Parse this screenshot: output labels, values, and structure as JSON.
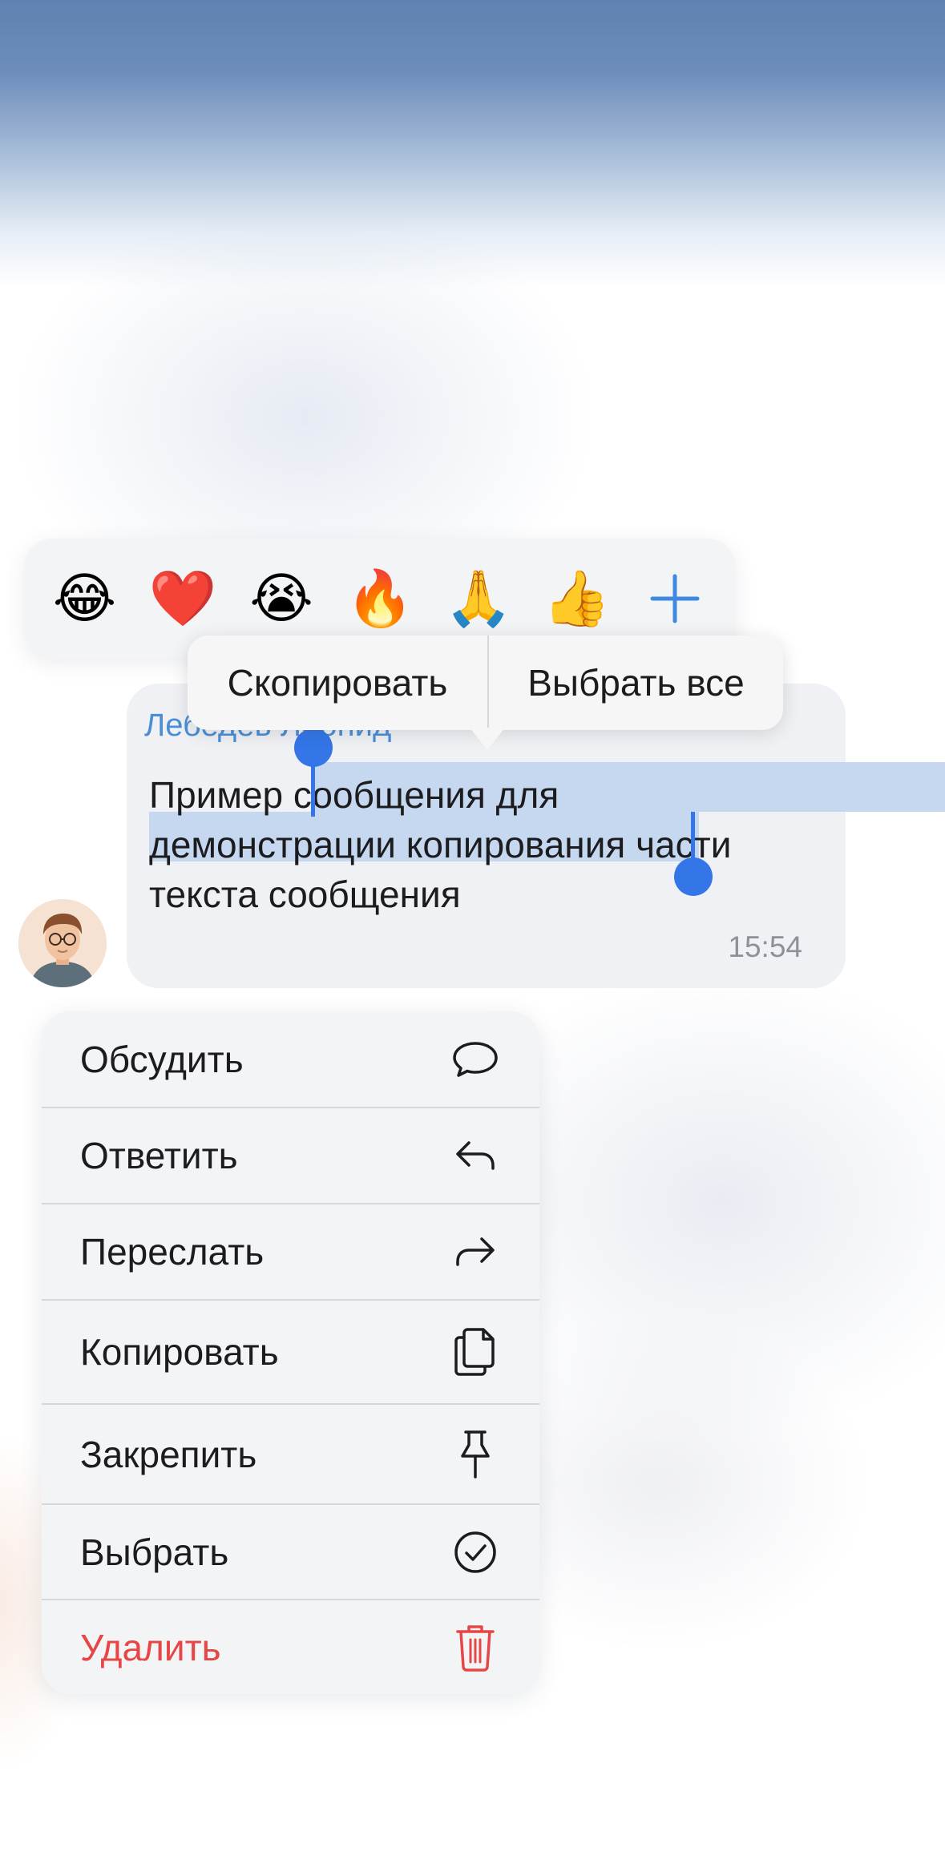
{
  "reactions": [
    "😂",
    "❤️",
    "😭",
    "🔥",
    "🙏",
    "👍",
    "+"
  ],
  "message": {
    "sender": "Лебедев Леонид",
    "lines": [
      "Пример сообщения для",
      "демонстрации копирования части",
      "текста сообщения"
    ],
    "time": "15:54"
  },
  "selection_popup": {
    "copy_label": "Скопировать",
    "select_all_label": "Выбрать все"
  },
  "context_menu": {
    "items": [
      {
        "label": "Обсудить",
        "icon": "chat-bubble-icon"
      },
      {
        "label": "Ответить",
        "icon": "reply-icon"
      },
      {
        "label": "Переслать",
        "icon": "forward-icon"
      },
      {
        "label": "Копировать",
        "icon": "copy-icon"
      },
      {
        "label": "Закрепить",
        "icon": "pin-icon"
      },
      {
        "label": "Выбрать",
        "icon": "check-circle-icon"
      },
      {
        "label": "Удалить",
        "icon": "trash-icon"
      }
    ]
  },
  "colors": {
    "accent": "#3476e8",
    "sender": "#4a8ed6",
    "danger": "#e64646",
    "selection": "#c6d8f0"
  }
}
